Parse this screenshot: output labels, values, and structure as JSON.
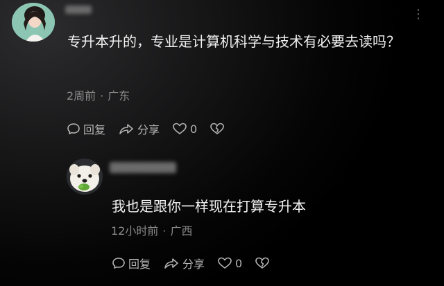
{
  "comments": [
    {
      "text": "专升本升的，专业是计算机科学与技术有必要去读吗？",
      "time": "2周前",
      "location": "广东",
      "separator": "·",
      "reply_label": "回复",
      "share_label": "分享",
      "like_count": "0",
      "avatar_icon": "woman-portrait-icon"
    },
    {
      "text": "我也是跟你一样现在打算专升本",
      "time": "12小时前",
      "location": "广西",
      "separator": "·",
      "reply_label": "回复",
      "share_label": "分享",
      "like_count": "0",
      "avatar_icon": "white-dog-icon"
    }
  ],
  "more_icon": "more-dots-icon",
  "colors": {
    "background": "#000000",
    "text": "#f2f2f2",
    "meta": "#8a8a8a",
    "action": "#b5b5b5"
  }
}
